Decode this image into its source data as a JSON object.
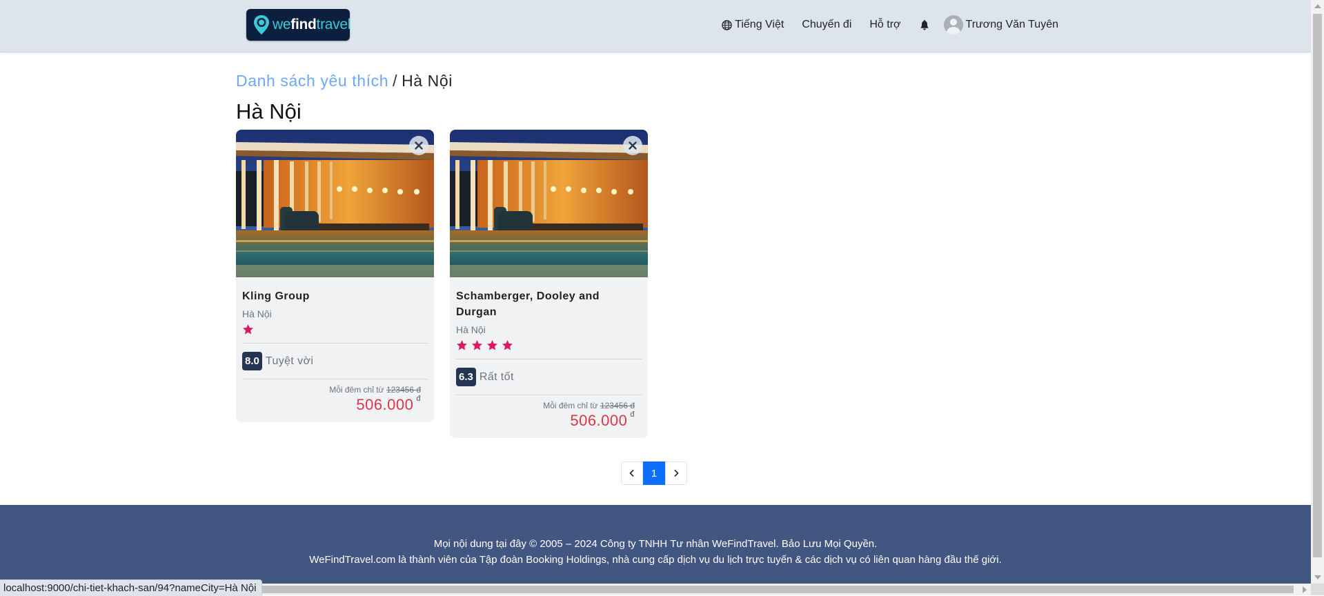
{
  "navbar": {
    "logo": {
      "text_part1": "we",
      "text_part2": "find",
      "text_part3": "travel"
    },
    "language": "Tiếng Việt",
    "trips": "Chuyến đi",
    "support": "Hỗ trợ",
    "user_name": "Trương Văn Tuyên"
  },
  "breadcrumb": {
    "link": "Danh sách yêu thích",
    "separator": "/",
    "current": "Hà Nội"
  },
  "page_title": "Hà Nội",
  "hotels": [
    {
      "name": "Kling Group",
      "city": "Hà Nội",
      "stars": 1,
      "score": "8.0",
      "score_label": "Tuyệt vời",
      "price_from_label": "Mỗi đêm chỉ từ",
      "old_price": "123456 đ",
      "price": "506.000",
      "currency": "đ"
    },
    {
      "name": "Schamberger, Dooley and Durgan",
      "city": "Hà Nội",
      "stars": 4,
      "score": "6.3",
      "score_label": "Rất tốt",
      "price_from_label": "Mỗi đêm chỉ từ",
      "old_price": "123456 đ",
      "price": "506.000",
      "currency": "đ"
    }
  ],
  "pagination": {
    "current_page": "1"
  },
  "footer": {
    "line1": "Mọi nội dung tại đây © 2005 – 2024 Công ty TNHH Tư nhân WeFindTravel. Bảo Lưu Mọi Quyền.",
    "line2": "WeFindTravel.com là thành viên của Tập đoàn Booking Holdings, nhà cung cấp dịch vụ du lịch trực tuyến & các dịch vụ có liên quan hàng đầu thế giới."
  },
  "status_url": "localhost:9000/chi-tiet-khach-san/94?nameCity=Hà Nội",
  "colors": {
    "navbar_bg": "#dde4ec",
    "logo_bg": "#0c1f3f",
    "star": "#d81b60",
    "score_badge": "#243552",
    "price": "#dc3545",
    "footer_bg": "#425682",
    "pagination_active": "#0d6efd"
  },
  "icons": [
    "globe-icon",
    "bell-icon",
    "avatar",
    "close-icon",
    "star-icon",
    "chevron-left-icon",
    "chevron-right-icon",
    "location-pin-icon"
  ]
}
